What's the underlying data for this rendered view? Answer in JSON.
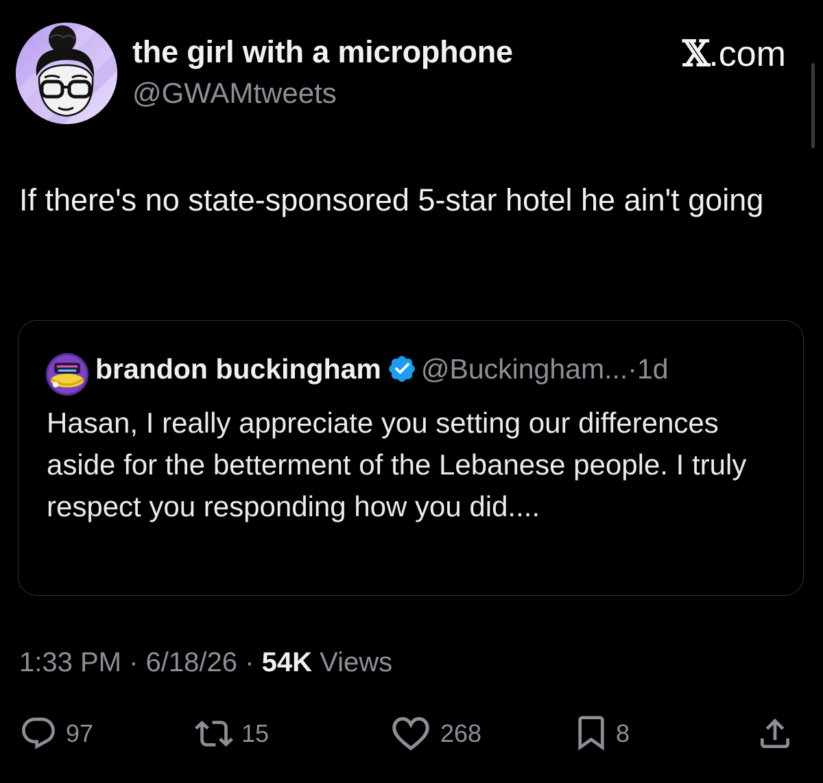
{
  "author": {
    "display_name": "the girl with a microphone",
    "handle": "@GWAMtweets",
    "avatar": "cartoon-woman-glasses-avatar"
  },
  "site_label": {
    "glyph": "𝕏",
    "suffix": ".com"
  },
  "tweet": {
    "text": "If there's no state-sponsored 5-star hotel he ain't going"
  },
  "quoted_tweet": {
    "display_name": "brandon buckingham",
    "verified": true,
    "handle": "@Buckingham...",
    "separator": "·",
    "time": "1d",
    "text": "Hasan, I really appreciate you setting our differences aside for the betterment of the Lebanese people. I truly respect you responding how you did....",
    "avatar": "show-logo-avatar"
  },
  "meta": {
    "time": "1:33 PM",
    "sep1": "·",
    "date": "6/18/26",
    "sep2": "·",
    "views_count": "54K",
    "views_label": "Views"
  },
  "actions": {
    "reply_count": "97",
    "repost_count": "15",
    "like_count": "268",
    "bookmark_count": "8"
  },
  "colors": {
    "background": "#000000",
    "text_primary": "#e7e9ea",
    "text_secondary": "#8b9097",
    "verified_blue": "#1d9bf0",
    "card_border": "#2f3336"
  }
}
